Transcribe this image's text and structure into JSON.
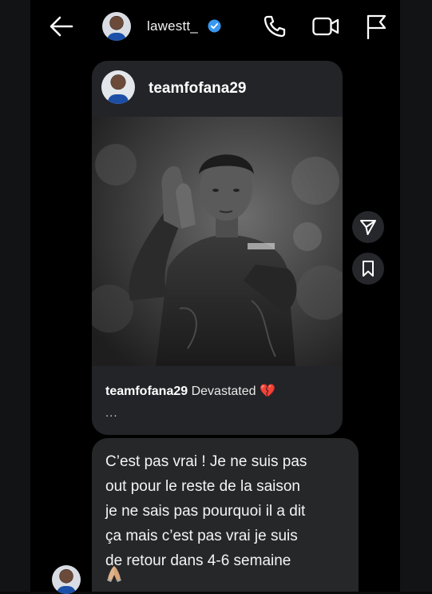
{
  "header": {
    "username": "lawestt_",
    "icons": {
      "back": "back-arrow-icon",
      "verified": "verified-badge-icon",
      "call": "phone-icon",
      "video": "video-camera-icon",
      "report": "flag-icon"
    },
    "verified_color": "#3897f0"
  },
  "shared_post": {
    "username": "teamfofana29",
    "caption_user": "teamfofana29",
    "caption_text": " Devastated 💔",
    "more": "...",
    "image": "black-and-white photo of a football player applauding",
    "actions": {
      "share": "send-icon",
      "save": "bookmark-icon"
    }
  },
  "message": {
    "text": "C’est pas vrai ! Je ne suis pas\nout pour le reste de la saison\nje ne sais pas pourquoi il a dit\nça mais c’est pas vrai je suis\nde retour dans 4-6 semaine",
    "emoji": "🙏"
  },
  "colors": {
    "background": "#000000",
    "bubble": "#262729",
    "card": "#232428"
  }
}
